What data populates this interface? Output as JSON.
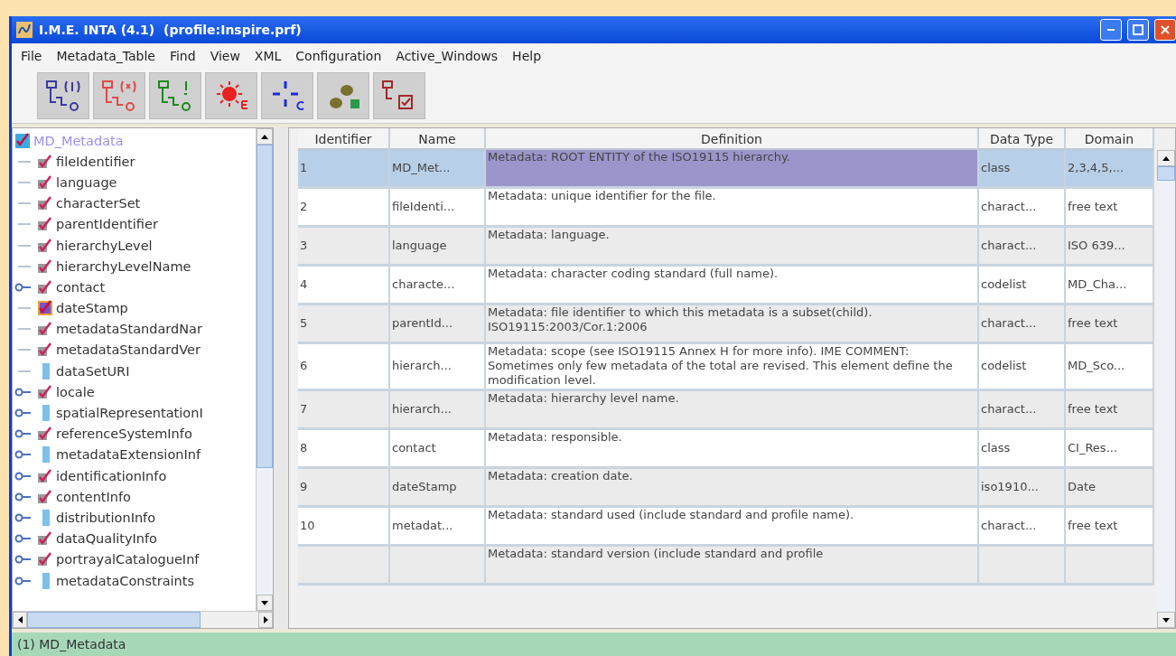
{
  "window": {
    "title": "I.M.E. INTA (4.1)  (profile:Inspire.prf)"
  },
  "menu": [
    "File",
    "Metadata_Table",
    "Find",
    "View",
    "XML",
    "Configuration",
    "Active_Windows",
    "Help"
  ],
  "toolbar": [
    {
      "kind": "tree-one"
    },
    {
      "kind": "tree-many"
    },
    {
      "kind": "tree-check"
    },
    {
      "kind": "sun"
    },
    {
      "kind": "cross"
    },
    {
      "kind": "animals"
    },
    {
      "kind": "tree-box"
    }
  ],
  "tree": {
    "label": "MD_Metadata",
    "selected": true,
    "children": [
      {
        "label": "fileIdentifier",
        "kind": "check",
        "expandable": false,
        "selected": false
      },
      {
        "label": "language",
        "kind": "check",
        "expandable": false,
        "selected": false
      },
      {
        "label": "characterSet",
        "kind": "check",
        "expandable": false,
        "selected": false
      },
      {
        "label": "parentIdentifier",
        "kind": "check",
        "expandable": false,
        "selected": false
      },
      {
        "label": "hierarchyLevel",
        "kind": "check",
        "expandable": false,
        "selected": false
      },
      {
        "label": "hierarchyLevelName",
        "kind": "check",
        "expandable": false,
        "selected": false
      },
      {
        "label": "contact",
        "kind": "check",
        "expandable": true,
        "selected": false
      },
      {
        "label": "dateStamp",
        "kind": "date",
        "expandable": false,
        "selected": false
      },
      {
        "label": "metadataStandardNar",
        "kind": "check",
        "expandable": false,
        "selected": false
      },
      {
        "label": "metadataStandardVer",
        "kind": "check",
        "expandable": false,
        "selected": false
      },
      {
        "label": "dataSetURI",
        "kind": "blank",
        "expandable": false,
        "selected": false
      },
      {
        "label": "locale",
        "kind": "check",
        "expandable": true,
        "selected": false
      },
      {
        "label": "spatialRepresentationI",
        "kind": "blank",
        "expandable": true,
        "selected": false
      },
      {
        "label": "referenceSystemInfo",
        "kind": "check",
        "expandable": true,
        "selected": false
      },
      {
        "label": "metadataExtensionInf",
        "kind": "blank",
        "expandable": true,
        "selected": false
      },
      {
        "label": "identificationInfo",
        "kind": "check",
        "expandable": true,
        "selected": false
      },
      {
        "label": "contentInfo",
        "kind": "check",
        "expandable": true,
        "selected": false
      },
      {
        "label": "distributionInfo",
        "kind": "blank",
        "expandable": true,
        "selected": false
      },
      {
        "label": "dataQualityInfo",
        "kind": "check",
        "expandable": true,
        "selected": false
      },
      {
        "label": "portrayalCatalogueInf",
        "kind": "check",
        "expandable": true,
        "selected": false
      },
      {
        "label": "metadataConstraints",
        "kind": "blank",
        "expandable": true,
        "selected": false
      }
    ]
  },
  "table": {
    "columns": [
      "Identifier",
      "Name",
      "Definition",
      "Data Type",
      "Domain"
    ],
    "rows": [
      {
        "selected": true,
        "cells": [
          "1",
          "MD_Met...",
          "Metadata: ROOT ENTITY of the ISO19115 hierarchy.",
          "class",
          "2,3,4,5,..."
        ]
      },
      {
        "selected": false,
        "cells": [
          "2",
          "fileIdenti...",
          "Metadata: unique identifier for the file.",
          "charact...",
          "free text"
        ]
      },
      {
        "selected": false,
        "cells": [
          "3",
          "language",
          "Metadata: language.",
          "charact...",
          "ISO 639..."
        ]
      },
      {
        "selected": false,
        "cells": [
          "4",
          "characte...",
          "Metadata: character coding standard (full name).",
          "codelist",
          "MD_Cha..."
        ]
      },
      {
        "selected": false,
        "cells": [
          "5",
          "parentId...",
          "Metadata: file identifier to which this metadata is a subset(child). ISO19115:2003/Cor.1:2006",
          "charact...",
          "free text"
        ]
      },
      {
        "selected": false,
        "cells": [
          "6",
          "hierarch...",
          "Metadata: scope (see ISO19115 Annex H for more info). IME COMMENT: Sometimes only few metadata of the total are revised. This element define the modification level.",
          "codelist",
          "MD_Sco..."
        ]
      },
      {
        "selected": false,
        "cells": [
          "7",
          "hierarch...",
          "Metadata: hierarchy level name.",
          "charact...",
          "free text"
        ]
      },
      {
        "selected": false,
        "cells": [
          "8",
          "contact",
          "Metadata: responsible.",
          "class",
          "CI_Res..."
        ]
      },
      {
        "selected": false,
        "cells": [
          "9",
          "dateStamp",
          "Metadata: creation date.",
          "iso1910...",
          "Date"
        ]
      },
      {
        "selected": false,
        "cells": [
          "10",
          "metadat...",
          "Metadata: standard used (include standard and profile name).",
          "charact...",
          "free text"
        ]
      },
      {
        "selected": false,
        "cells": [
          "",
          "",
          "Metadata: standard version (include standard and profile",
          "",
          ""
        ]
      }
    ]
  },
  "status_bar": "(1) MD_Metadata"
}
